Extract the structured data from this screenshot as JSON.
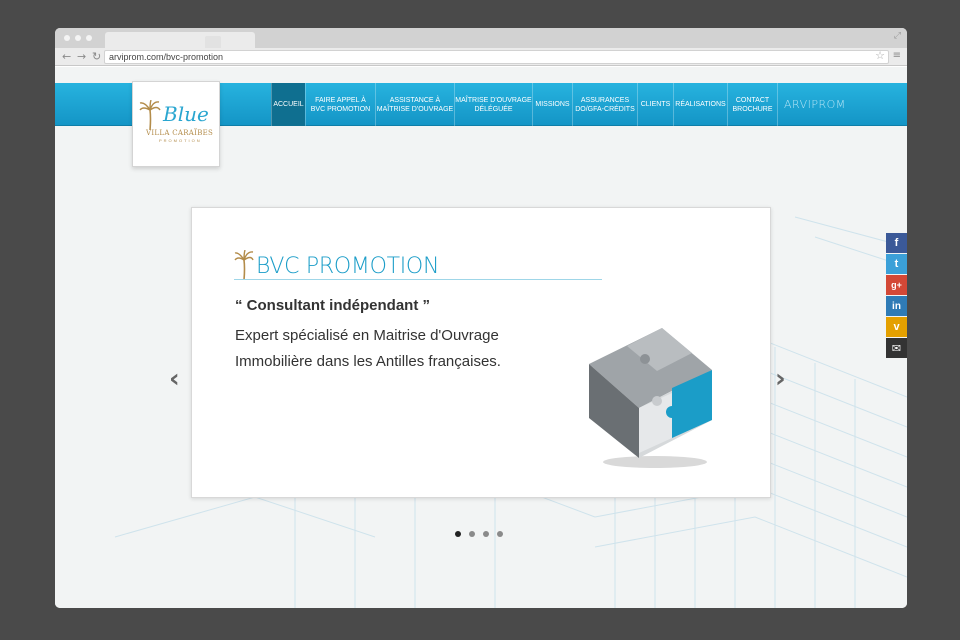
{
  "browser": {
    "url": "arviprom.com/bvc-promotion",
    "icons": [
      "back-arrow-icon",
      "forward-arrow-icon",
      "reload-icon",
      "star-icon",
      "menu-icon",
      "expand-icon"
    ]
  },
  "logo": {
    "word": "Blue",
    "subtitle": "VILLA CARAÏBES",
    "tagline": "PROMOTION"
  },
  "nav": {
    "items": [
      {
        "label": "ACCUEIL",
        "active": true
      },
      {
        "label": "FAIRE APPEL À\nBVC PROMOTION",
        "active": false
      },
      {
        "label": "ASSISTANCE À\nMAÎTRISE D'OUVRAGE",
        "active": false
      },
      {
        "label": "MAÎTRISE D'OUVRAGE\nDÉLÉGUÉE",
        "active": false
      },
      {
        "label": "MISSIONS",
        "active": false
      },
      {
        "label": "ASSURANCES\nDO/GFA-CRÉDITS",
        "active": false
      },
      {
        "label": "CLIENTS",
        "active": false
      },
      {
        "label": "RÉALISATIONS",
        "active": false
      },
      {
        "label": "CONTACT\nBROCHURE",
        "active": false
      }
    ],
    "brand": "ARVIPROM"
  },
  "slide": {
    "title": "BVC PROMOTION",
    "quote": "“ Consultant indépendant ”",
    "line1": "Expert spécialisé en Maitrise d'Ouvrage",
    "line2": "Immobilière dans les Antilles françaises."
  },
  "carousel": {
    "prev_icon": "chevron-left-icon",
    "next_icon": "chevron-right-icon",
    "slides_count": 4,
    "active_index": 0
  },
  "social": [
    {
      "name": "facebook-icon",
      "glyph": "f",
      "color": "#3b5998"
    },
    {
      "name": "twitter-icon",
      "glyph": "t",
      "color": "#3ba0d8"
    },
    {
      "name": "google-plus-icon",
      "glyph": "g+",
      "color": "#d34836"
    },
    {
      "name": "linkedin-icon",
      "glyph": "in",
      "color": "#2f7bb6"
    },
    {
      "name": "viadeo-icon",
      "glyph": "v",
      "color": "#e4a000"
    },
    {
      "name": "email-icon",
      "glyph": "✉",
      "color": "#333333"
    }
  ],
  "colors": {
    "accent": "#1b9dc8",
    "nav_active": "#0f6f90",
    "gold": "#b38c4a"
  }
}
